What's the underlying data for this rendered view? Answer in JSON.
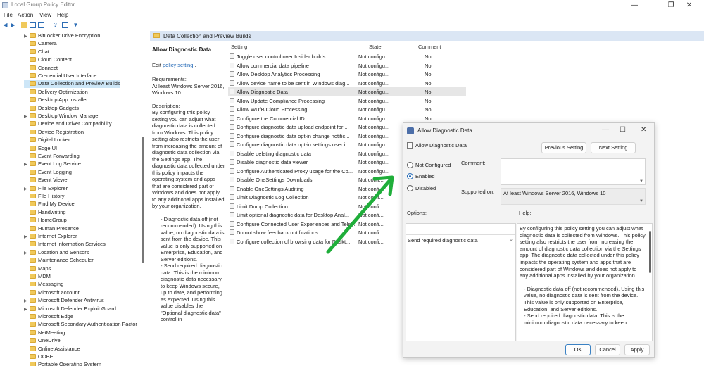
{
  "window": {
    "title": "Local Group Policy Editor"
  },
  "menu": [
    "File",
    "Action",
    "View",
    "Help"
  ],
  "tree": {
    "items": [
      {
        "label": "BitLocker Drive Encryption",
        "expand": true
      },
      {
        "label": "Camera"
      },
      {
        "label": "Chat"
      },
      {
        "label": "Cloud Content"
      },
      {
        "label": "Connect"
      },
      {
        "label": "Credential User Interface"
      },
      {
        "label": "Data Collection and Preview Builds",
        "selected": true
      },
      {
        "label": "Delivery Optimization"
      },
      {
        "label": "Desktop App Installer"
      },
      {
        "label": "Desktop Gadgets"
      },
      {
        "label": "Desktop Window Manager",
        "expand": true
      },
      {
        "label": "Device and Driver Compatibility"
      },
      {
        "label": "Device Registration"
      },
      {
        "label": "Digital Locker"
      },
      {
        "label": "Edge UI"
      },
      {
        "label": "Event Forwarding"
      },
      {
        "label": "Event Log Service",
        "expand": true
      },
      {
        "label": "Event Logging"
      },
      {
        "label": "Event Viewer"
      },
      {
        "label": "File Explorer",
        "expand": true
      },
      {
        "label": "File History"
      },
      {
        "label": "Find My Device"
      },
      {
        "label": "Handwriting"
      },
      {
        "label": "HomeGroup"
      },
      {
        "label": "Human Presence"
      },
      {
        "label": "Internet Explorer",
        "expand": true
      },
      {
        "label": "Internet Information Services"
      },
      {
        "label": "Location and Sensors",
        "expand": true
      },
      {
        "label": "Maintenance Scheduler"
      },
      {
        "label": "Maps"
      },
      {
        "label": "MDM"
      },
      {
        "label": "Messaging"
      },
      {
        "label": "Microsoft account"
      },
      {
        "label": "Microsoft Defender Antivirus",
        "expand": true
      },
      {
        "label": "Microsoft Defender Exploit Guard",
        "expand": true
      },
      {
        "label": "Microsoft Edge"
      },
      {
        "label": "Microsoft Secondary Authentication Factor"
      },
      {
        "label": "NetMeeting"
      },
      {
        "label": "OneDrive"
      },
      {
        "label": "Online Assistance"
      },
      {
        "label": "OOBE"
      },
      {
        "label": "Portable Operating System"
      }
    ]
  },
  "breadcrumb": "Data Collection and Preview Builds",
  "description": {
    "title": "Allow Diagnostic Data",
    "edit_prefix": "Edit ",
    "edit_link": "policy setting",
    "edit_suffix": " .",
    "requirements_label": "Requirements:",
    "requirements": "At least Windows Server 2016, Windows 10",
    "description_label": "Description:",
    "body": "By configuring this policy setting you can adjust what diagnostic data is collected from Windows. This policy setting also restricts the user from increasing the amount of diagnostic data collection via the Settings app. The diagnostic data collected under this policy impacts the operating system and apps that are considered part of Windows and does not apply to any additional apps installed by your organization.",
    "body2": "- Diagnostic data off (not recommended). Using this value, no diagnostic data is sent from the device. This value is only supported on Enterprise, Education, and Server editions.",
    "body3": "- Send required diagnostic data. This is the minimum diagnostic data necessary to keep Windows secure, up to date, and performing as expected. Using this value disables the \"Optional diagnostic data\" control in"
  },
  "columns": {
    "setting": "Setting",
    "state": "State",
    "comment": "Comment"
  },
  "settings": [
    {
      "name": "Toggle user control over Insider builds",
      "state": "Not configu...",
      "comment": "No"
    },
    {
      "name": "Allow commercial data pipeline",
      "state": "Not configu...",
      "comment": "No"
    },
    {
      "name": "Allow Desktop Analytics Processing",
      "state": "Not configu...",
      "comment": "No"
    },
    {
      "name": "Allow device name to be sent in Windows diag...",
      "state": "Not configu...",
      "comment": "No"
    },
    {
      "name": "Allow Diagnostic Data",
      "state": "Not configu...",
      "comment": "No",
      "selected": true
    },
    {
      "name": "Allow Update Compliance Processing",
      "state": "Not configu...",
      "comment": "No"
    },
    {
      "name": "Allow WUfB Cloud Processing",
      "state": "Not configu...",
      "comment": "No"
    },
    {
      "name": "Configure the Commercial ID",
      "state": "Not configu...",
      "comment": "No"
    },
    {
      "name": "Configure diagnostic data upload endpoint for ...",
      "state": "Not configu...",
      "comment": ""
    },
    {
      "name": "Configure diagnostic data opt-in change notific...",
      "state": "Not configu...",
      "comment": ""
    },
    {
      "name": "Configure diagnostic data opt-in settings user i...",
      "state": "Not configu...",
      "comment": ""
    },
    {
      "name": "Disable deleting diagnostic data",
      "state": "Not configu...",
      "comment": ""
    },
    {
      "name": "Disable diagnostic data viewer",
      "state": "Not configu...",
      "comment": ""
    },
    {
      "name": "Configure Authenticated Proxy usage for the Co...",
      "state": "Not configu...",
      "comment": ""
    },
    {
      "name": "Disable OneSettings Downloads",
      "state": "Not confi...",
      "comment": ""
    },
    {
      "name": "Enable OneSettings Auditing",
      "state": "Not confi...",
      "comment": ""
    },
    {
      "name": "Limit Diagnostic Log Collection",
      "state": "Not confi...",
      "comment": ""
    },
    {
      "name": "Limit Dump Collection",
      "state": "Not confi...",
      "comment": ""
    },
    {
      "name": "Limit optional diagnostic data for Desktop Anal...",
      "state": "Not confi...",
      "comment": ""
    },
    {
      "name": "Configure Connected User Experiences and Tele...",
      "state": "Not confi...",
      "comment": ""
    },
    {
      "name": "Do not show feedback notifications",
      "state": "Not confi...",
      "comment": ""
    },
    {
      "name": "Configure collection of browsing data for Deskt...",
      "state": "Not confi...",
      "comment": ""
    }
  ],
  "dialog": {
    "title": "Allow Diagnostic Data",
    "subtitle": "Allow Diagnostic Data",
    "prev_button": "Previous Setting",
    "next_button": "Next Setting",
    "options": [
      "Not Configured",
      "Enabled",
      "Disabled"
    ],
    "selected_option": "Enabled",
    "comment_label": "Comment:",
    "supported_label": "Supported on:",
    "supported_value": "At least Windows Server 2016, Windows 10",
    "options_label": "Options:",
    "help_label": "Help:",
    "dropdown_value": "Send required diagnostic data",
    "help_text": "By configuring this policy setting you can adjust what diagnostic data is collected from Windows. This policy setting also restricts the user from increasing the amount of diagnostic data collection via the Settings app. The diagnostic data collected under this policy impacts the operating system and apps that are considered part of Windows and does not apply to any additional apps installed by your organization.",
    "help_text2": "- Diagnostic data off (not recommended). Using this value, no diagnostic data is sent from the device. This value is only supported on Enterprise, Education, and Server editions.",
    "help_text3": "- Send required diagnostic data. This is the minimum diagnostic data necessary to keep",
    "ok_button": "OK",
    "cancel_button": "Cancel",
    "apply_button": "Apply"
  },
  "colors": {
    "selection": "#cde6f7",
    "header": "#dbe6f4",
    "accent": "#1a63b4",
    "annotation_arrow": "#1fae3a"
  }
}
